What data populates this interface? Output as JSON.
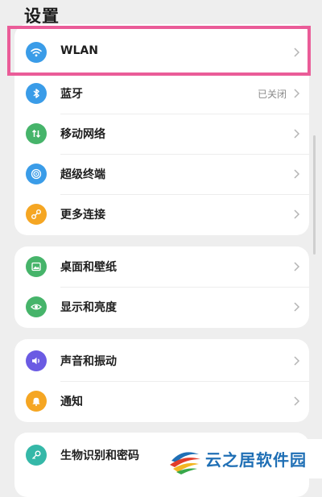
{
  "header": {
    "title": "设置"
  },
  "groups": [
    {
      "items": [
        {
          "label": "WLAN",
          "status": "",
          "icon": "wifi-icon",
          "color": "#3a9ce8"
        },
        {
          "label": "蓝牙",
          "status": "已关闭",
          "icon": "bluetooth-icon",
          "color": "#3a9ce8"
        },
        {
          "label": "移动网络",
          "status": "",
          "icon": "mobile-network-icon",
          "color": "#46b46a"
        },
        {
          "label": "超级终端",
          "status": "",
          "icon": "super-device-icon",
          "color": "#3a9ce8"
        },
        {
          "label": "更多连接",
          "status": "",
          "icon": "more-connections-icon",
          "color": "#f5a623"
        }
      ]
    },
    {
      "items": [
        {
          "label": "桌面和壁纸",
          "status": "",
          "icon": "wallpaper-icon",
          "color": "#46b46a"
        },
        {
          "label": "显示和亮度",
          "status": "",
          "icon": "display-eye-icon",
          "color": "#46b46a"
        }
      ]
    },
    {
      "items": [
        {
          "label": "声音和振动",
          "status": "",
          "icon": "sound-icon",
          "color": "#6b5be3"
        },
        {
          "label": "通知",
          "status": "",
          "icon": "bell-icon",
          "color": "#f5a623"
        }
      ]
    },
    {
      "items": [
        {
          "label": "生物识别和密码",
          "status": "",
          "icon": "key-icon",
          "color": "#35b8a8"
        }
      ]
    }
  ],
  "highlight_color": "#ea5c98",
  "watermark": {
    "text": "云之居软件园"
  }
}
